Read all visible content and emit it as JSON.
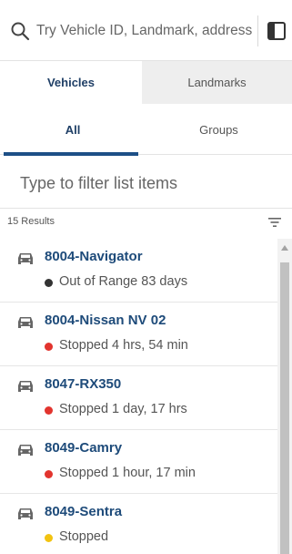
{
  "search": {
    "placeholder": "Try Vehicle ID, Landmark, address"
  },
  "top_tabs": [
    {
      "label": "Vehicles",
      "active": true
    },
    {
      "label": "Landmarks",
      "active": false
    }
  ],
  "sub_tabs": [
    {
      "label": "All",
      "active": true
    },
    {
      "label": "Groups",
      "active": false
    }
  ],
  "filter": {
    "placeholder": "Type to filter list items"
  },
  "results": {
    "count_label": "15 Results"
  },
  "status_colors": {
    "gray": "#333333",
    "red": "#e2342e",
    "yellow": "#f2c311"
  },
  "accent_color": "#1d4f86",
  "icons": {
    "search": "search-icon",
    "panel": "panel-toggle-icon",
    "sort": "sort-icon",
    "vehicle": "car-icon"
  },
  "vehicles": [
    {
      "name": "8004-Navigator",
      "status": "Out of Range 83 days",
      "status_color": "#333333"
    },
    {
      "name": "8004-Nissan NV 02",
      "status": "Stopped 4 hrs, 54 min",
      "status_color": "#e2342e"
    },
    {
      "name": "8047-RX350",
      "status": "Stopped 1 day, 17 hrs",
      "status_color": "#e2342e"
    },
    {
      "name": "8049-Camry",
      "status": "Stopped 1 hour, 17 min",
      "status_color": "#e2342e"
    },
    {
      "name": "8049-Sentra",
      "status": "Stopped",
      "status_color": "#f2c311"
    }
  ]
}
